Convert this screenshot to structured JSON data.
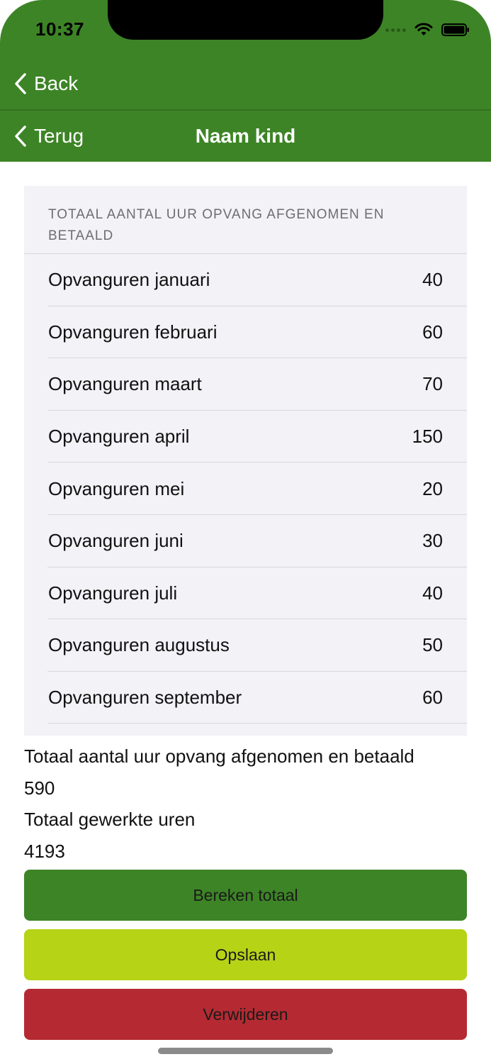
{
  "status_bar": {
    "time": "10:37"
  },
  "nav": {
    "back_label": "Back",
    "terug_label": "Terug",
    "title": "Naam kind"
  },
  "section": {
    "header": "TOTAAL AANTAL UUR OPVANG AFGENOMEN EN BETAALD",
    "rows": [
      {
        "label": "Opvanguren januari",
        "value": "40"
      },
      {
        "label": "Opvanguren februari",
        "value": "60"
      },
      {
        "label": "Opvanguren maart",
        "value": "70"
      },
      {
        "label": "Opvanguren april",
        "value": "150"
      },
      {
        "label": "Opvanguren mei",
        "value": "20"
      },
      {
        "label": "Opvanguren juni",
        "value": "30"
      },
      {
        "label": "Opvanguren juli",
        "value": "40"
      },
      {
        "label": "Opvanguren augustus",
        "value": "50"
      },
      {
        "label": "Opvanguren september",
        "value": "60"
      }
    ]
  },
  "summary": {
    "total_label": "Totaal aantal uur opvang afgenomen en betaald",
    "total_value": "590",
    "worked_label": "Totaal gewerkte uren",
    "worked_value": "4193"
  },
  "buttons": {
    "calculate": "Bereken totaal",
    "save": "Opslaan",
    "delete": "Verwijderen"
  },
  "colors": {
    "header_green": "#3d8426",
    "save_lime": "#b6d316",
    "delete_red": "#b52a32"
  }
}
